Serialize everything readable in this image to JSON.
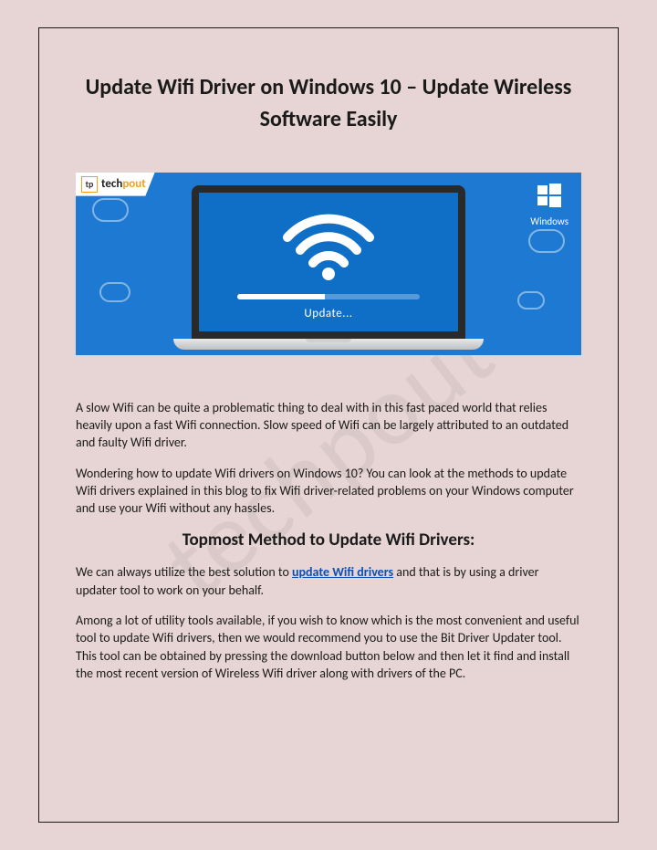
{
  "watermark": "techpout",
  "title": "Update Wifi Driver on Windows 10 – Update Wireless Software Easily",
  "hero": {
    "brand_prefix": "tech",
    "brand_suffix": "pout",
    "brand_logo_letter": "tp",
    "windows_label": "Windows",
    "progress_label": "Update..."
  },
  "paragraphs": {
    "p1": "A slow Wifi can be quite a problematic thing to deal with in this fast paced world that relies heavily upon a fast Wifi connection. Slow speed of Wifi can be largely attributed to an outdated and faulty Wifi driver.",
    "p2": "Wondering how to update Wifi drivers on Windows 10? You can look at the methods to update Wifi drivers explained in this blog to fix Wifi driver-related problems on your Windows computer and use your Wifi without any hassles.",
    "subheading": "Topmost Method to Update Wifi Drivers:",
    "p3_pre": "We can always utilize the best solution to ",
    "p3_link": "update Wifi drivers",
    "p3_post": " and that is by using a driver updater tool to work on your behalf.",
    "p4": "Among a lot of utility tools available, if you wish to know which is the most convenient and useful tool to update Wifi drivers, then we would recommend you to use the Bit Driver Updater tool. This tool can be obtained by pressing the download button below and then let it find and install the most recent version of Wireless Wifi driver along with drivers of the PC."
  }
}
